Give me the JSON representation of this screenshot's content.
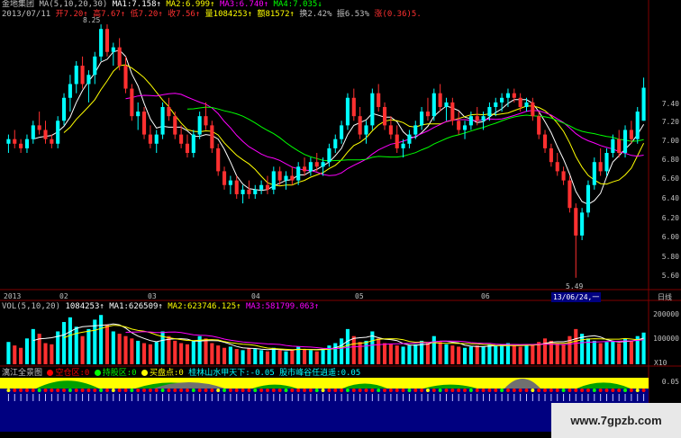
{
  "colors": {
    "up": "#00ffff",
    "down": "#ff3030",
    "ma1": "#ffffff",
    "ma2": "#ffff00",
    "ma3": "#ff00ff",
    "ma4": "#00ff00",
    "grid": "#800000",
    "axis": "#c0c0c0"
  },
  "header": {
    "stock_name": "金地集团",
    "ma_params": "MA(5,10,20,30)",
    "ma1": "MA1:7.158↑",
    "ma2": "MA2:6.999↑",
    "ma3": "MA3:6.740↑",
    "ma4": "MA4:7.035↓",
    "date": "2013/07/11",
    "open": "开7.20↑",
    "high": "高7.67↑",
    "low": "低7.20↑",
    "close": "收7.56↑",
    "volume": "量1084253↑",
    "amount": "额81572↑",
    "turnover": "换2.42%",
    "amplitude": "振6.53%",
    "change": "涨(0.36)5.",
    "peak_label": "8.25",
    "trough_label": "5.49"
  },
  "price_axis": [
    "7.40",
    "7.20",
    "7.00",
    "6.80",
    "6.60",
    "6.40",
    "6.20",
    "6.00",
    "5.80",
    "5.60"
  ],
  "date_axis": {
    "year": "2013",
    "months": [
      "02",
      "03",
      "04",
      "05",
      "06"
    ],
    "cursor": "13/06/24,一",
    "period": "日线"
  },
  "vol_panel": {
    "title": "VOL(5,10,20)",
    "v": "1084253↑",
    "ma1": "MA1:626509↑",
    "ma2": "MA2:623746.125↑",
    "ma3": "MA3:581799.063↑",
    "axis": [
      "200000",
      "100000",
      "X10"
    ]
  },
  "indicator_panel": {
    "title": "漓江全景图",
    "items": [
      {
        "label": "空仓区:0",
        "color": "#ff0000"
      },
      {
        "label": "持股区:0",
        "color": "#00ff00"
      },
      {
        "label": "买盘点:0",
        "color": "#ffff00"
      }
    ],
    "text1": "桂林山水甲天下:-0.05",
    "text2": "股市峰谷任逍遥:0.05",
    "axis_value": "0.05"
  },
  "watermark": "www.7gpzb.com",
  "chart_data": {
    "type": "candlestick",
    "y_range": [
      5.4,
      8.3
    ],
    "candles": [
      [
        6.95,
        7.05,
        6.85,
        7.0
      ],
      [
        7.0,
        7.1,
        6.9,
        6.95
      ],
      [
        6.95,
        7.0,
        6.85,
        6.9
      ],
      [
        6.9,
        7.05,
        6.85,
        7.0
      ],
      [
        7.0,
        7.2,
        6.95,
        7.15
      ],
      [
        7.15,
        7.3,
        7.05,
        7.1
      ],
      [
        7.1,
        7.2,
        6.95,
        7.0
      ],
      [
        7.0,
        7.05,
        6.9,
        6.95
      ],
      [
        6.95,
        7.25,
        6.9,
        7.2
      ],
      [
        7.2,
        7.5,
        7.15,
        7.45
      ],
      [
        7.45,
        7.7,
        7.3,
        7.6
      ],
      [
        7.6,
        7.85,
        7.5,
        7.8
      ],
      [
        7.8,
        7.9,
        7.55,
        7.6
      ],
      [
        7.6,
        7.75,
        7.4,
        7.7
      ],
      [
        7.7,
        7.95,
        7.6,
        7.9
      ],
      [
        7.9,
        8.25,
        7.85,
        8.2
      ],
      [
        8.2,
        8.25,
        7.9,
        7.95
      ],
      [
        7.95,
        8.05,
        7.8,
        8.0
      ],
      [
        8.0,
        8.1,
        7.75,
        7.8
      ],
      [
        7.8,
        7.9,
        7.5,
        7.55
      ],
      [
        7.55,
        7.6,
        7.2,
        7.25
      ],
      [
        7.25,
        7.4,
        7.1,
        7.3
      ],
      [
        7.3,
        7.35,
        7.0,
        7.05
      ],
      [
        7.05,
        7.15,
        6.9,
        6.95
      ],
      [
        6.95,
        7.1,
        6.85,
        7.05
      ],
      [
        7.05,
        7.4,
        7.0,
        7.35
      ],
      [
        7.35,
        7.45,
        7.2,
        7.25
      ],
      [
        7.25,
        7.3,
        7.0,
        7.05
      ],
      [
        7.05,
        7.15,
        6.9,
        6.95
      ],
      [
        6.95,
        7.05,
        6.8,
        6.85
      ],
      [
        6.85,
        7.1,
        6.8,
        7.05
      ],
      [
        7.05,
        7.3,
        7.0,
        7.25
      ],
      [
        7.25,
        7.4,
        7.1,
        7.15
      ],
      [
        7.15,
        7.2,
        6.85,
        6.9
      ],
      [
        6.9,
        6.95,
        6.6,
        6.65
      ],
      [
        6.65,
        6.7,
        6.45,
        6.5
      ],
      [
        6.5,
        6.6,
        6.4,
        6.55
      ],
      [
        6.55,
        6.6,
        6.35,
        6.4
      ],
      [
        6.4,
        6.5,
        6.3,
        6.45
      ],
      [
        6.45,
        6.55,
        6.35,
        6.4
      ],
      [
        6.4,
        6.5,
        6.35,
        6.45
      ],
      [
        6.45,
        6.55,
        6.4,
        6.5
      ],
      [
        6.5,
        6.6,
        6.4,
        6.45
      ],
      [
        6.45,
        6.7,
        6.4,
        6.65
      ],
      [
        6.65,
        6.7,
        6.5,
        6.55
      ],
      [
        6.55,
        6.65,
        6.45,
        6.6
      ],
      [
        6.6,
        6.7,
        6.5,
        6.55
      ],
      [
        6.55,
        6.75,
        6.5,
        6.7
      ],
      [
        6.7,
        6.8,
        6.6,
        6.65
      ],
      [
        6.65,
        6.8,
        6.6,
        6.75
      ],
      [
        6.75,
        6.85,
        6.65,
        6.7
      ],
      [
        6.7,
        6.8,
        6.6,
        6.75
      ],
      [
        6.75,
        6.95,
        6.7,
        6.9
      ],
      [
        6.9,
        7.05,
        6.85,
        7.0
      ],
      [
        7.0,
        7.2,
        6.95,
        7.15
      ],
      [
        7.15,
        7.5,
        7.1,
        7.45
      ],
      [
        7.45,
        7.55,
        7.2,
        7.25
      ],
      [
        7.25,
        7.35,
        7.0,
        7.05
      ],
      [
        7.05,
        7.2,
        6.95,
        7.15
      ],
      [
        7.15,
        7.55,
        7.1,
        7.5
      ],
      [
        7.5,
        7.6,
        7.3,
        7.35
      ],
      [
        7.35,
        7.4,
        7.1,
        7.15
      ],
      [
        7.15,
        7.25,
        7.0,
        7.05
      ],
      [
        7.05,
        7.15,
        6.85,
        6.9
      ],
      [
        6.9,
        7.0,
        6.8,
        6.95
      ],
      [
        6.95,
        7.1,
        6.9,
        7.05
      ],
      [
        7.05,
        7.2,
        7.0,
        7.15
      ],
      [
        7.15,
        7.35,
        7.1,
        7.3
      ],
      [
        7.3,
        7.45,
        7.2,
        7.25
      ],
      [
        7.25,
        7.55,
        7.2,
        7.5
      ],
      [
        7.5,
        7.6,
        7.3,
        7.35
      ],
      [
        7.35,
        7.45,
        7.2,
        7.4
      ],
      [
        7.4,
        7.45,
        7.15,
        7.2
      ],
      [
        7.2,
        7.3,
        7.05,
        7.1
      ],
      [
        7.1,
        7.2,
        7.0,
        7.15
      ],
      [
        7.15,
        7.3,
        7.1,
        7.25
      ],
      [
        7.25,
        7.35,
        7.15,
        7.2
      ],
      [
        7.2,
        7.3,
        7.1,
        7.25
      ],
      [
        7.25,
        7.4,
        7.2,
        7.35
      ],
      [
        7.35,
        7.45,
        7.25,
        7.4
      ],
      [
        7.4,
        7.5,
        7.3,
        7.45
      ],
      [
        7.45,
        7.55,
        7.35,
        7.5
      ],
      [
        7.5,
        7.55,
        7.4,
        7.45
      ],
      [
        7.45,
        7.5,
        7.3,
        7.35
      ],
      [
        7.35,
        7.45,
        7.3,
        7.4
      ],
      [
        7.4,
        7.45,
        7.2,
        7.25
      ],
      [
        7.25,
        7.3,
        7.0,
        7.05
      ],
      [
        7.05,
        7.1,
        6.85,
        6.9
      ],
      [
        6.9,
        6.95,
        6.7,
        6.75
      ],
      [
        6.75,
        6.85,
        6.6,
        6.65
      ],
      [
        6.65,
        6.7,
        6.5,
        6.55
      ],
      [
        6.55,
        6.6,
        6.2,
        6.25
      ],
      [
        6.25,
        6.3,
        5.49,
        5.95
      ],
      [
        5.95,
        6.25,
        5.9,
        6.2
      ],
      [
        6.2,
        6.55,
        6.15,
        6.5
      ],
      [
        6.5,
        6.8,
        6.45,
        6.75
      ],
      [
        6.75,
        6.9,
        6.6,
        6.65
      ],
      [
        6.65,
        6.9,
        6.6,
        6.85
      ],
      [
        6.85,
        7.05,
        6.8,
        7.0
      ],
      [
        7.0,
        7.1,
        6.8,
        6.85
      ],
      [
        6.85,
        7.15,
        6.8,
        7.1
      ],
      [
        7.1,
        7.2,
        6.95,
        7.0
      ],
      [
        7.0,
        7.35,
        6.95,
        7.3
      ],
      [
        7.2,
        7.67,
        7.2,
        7.56
      ]
    ],
    "volumes": [
      95,
      80,
      70,
      110,
      150,
      130,
      90,
      85,
      140,
      180,
      200,
      160,
      120,
      150,
      190,
      210,
      170,
      140,
      130,
      120,
      110,
      100,
      90,
      85,
      95,
      140,
      120,
      100,
      90,
      85,
      100,
      120,
      110,
      90,
      80,
      70,
      75,
      65,
      60,
      70,
      65,
      60,
      55,
      70,
      60,
      55,
      60,
      75,
      65,
      60,
      55,
      65,
      80,
      90,
      110,
      150,
      120,
      95,
      100,
      140,
      110,
      90,
      85,
      80,
      75,
      80,
      85,
      100,
      90,
      120,
      95,
      85,
      80,
      75,
      70,
      75,
      80,
      75,
      85,
      80,
      85,
      90,
      80,
      75,
      80,
      85,
      95,
      110,
      100,
      90,
      85,
      120,
      150,
      130,
      110,
      100,
      90,
      95,
      100,
      90,
      110,
      100,
      120,
      135
    ]
  }
}
